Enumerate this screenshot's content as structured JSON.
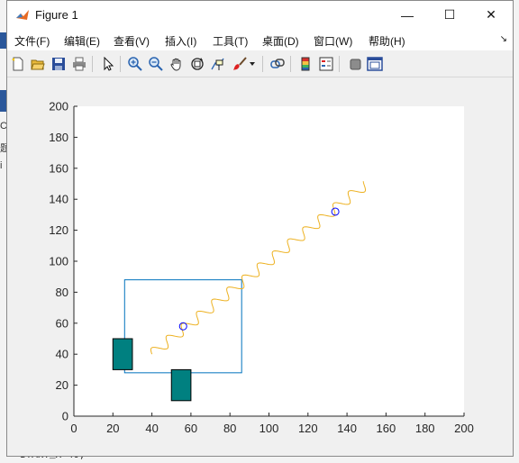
{
  "window": {
    "title": "Figure 1",
    "minimize_glyph": "—",
    "maximize_glyph": "☐",
    "close_glyph": "✕"
  },
  "menu": {
    "items": [
      "文件(F)",
      "编辑(E)",
      "查看(V)",
      "插入(I)",
      "工具(T)",
      "桌面(D)",
      "窗口(W)",
      "帮助(H)"
    ],
    "dock_glyph": "↘"
  },
  "toolbar": {
    "icons": [
      "new-figure-icon",
      "open-file-icon",
      "save-icon",
      "print-icon",
      "pointer-icon",
      "zoom-in-icon",
      "zoom-out-icon",
      "pan-icon",
      "rotate-3d-icon",
      "data-cursor-icon",
      "brush-icon",
      "brush-dropdown-icon",
      "link-plot-icon",
      "colorbar-icon",
      "legend-icon",
      "hide-plot-tools-icon",
      "show-plot-tools-icon"
    ]
  },
  "background": {
    "code_line": "START_X=40;",
    "peek_letters": [
      "C",
      "题",
      "i"
    ]
  },
  "chart_data": {
    "type": "line",
    "xlim": [
      0,
      200
    ],
    "ylim": [
      0,
      200
    ],
    "xticks": [
      0,
      20,
      40,
      60,
      80,
      100,
      120,
      140,
      160,
      180,
      200
    ],
    "yticks": [
      0,
      20,
      40,
      60,
      80,
      100,
      120,
      140,
      160,
      180,
      200
    ],
    "grid": false,
    "series": [
      {
        "style": "sine-wave diagonal path",
        "color": "#edb120",
        "x_start": 40,
        "y_start": 40,
        "x_end": 150,
        "y_end": 150,
        "amplitude": 3,
        "period": 11
      }
    ],
    "markers": [
      {
        "shape": "circle",
        "color": "#0000ff",
        "x": 56,
        "y": 58
      },
      {
        "shape": "circle",
        "color": "#0000ff",
        "x": 134,
        "y": 132
      }
    ],
    "rectangles": [
      {
        "role": "outline",
        "x": [
          26,
          86
        ],
        "y": [
          28,
          88
        ],
        "edge": "#0072bd",
        "fill": "none"
      },
      {
        "role": "filled",
        "x": [
          20,
          30
        ],
        "y": [
          30,
          50
        ],
        "edge": "#000000",
        "fill": "#008080"
      },
      {
        "role": "filled",
        "x": [
          50,
          60
        ],
        "y": [
          10,
          30
        ],
        "edge": "#000000",
        "fill": "#008080"
      }
    ]
  }
}
